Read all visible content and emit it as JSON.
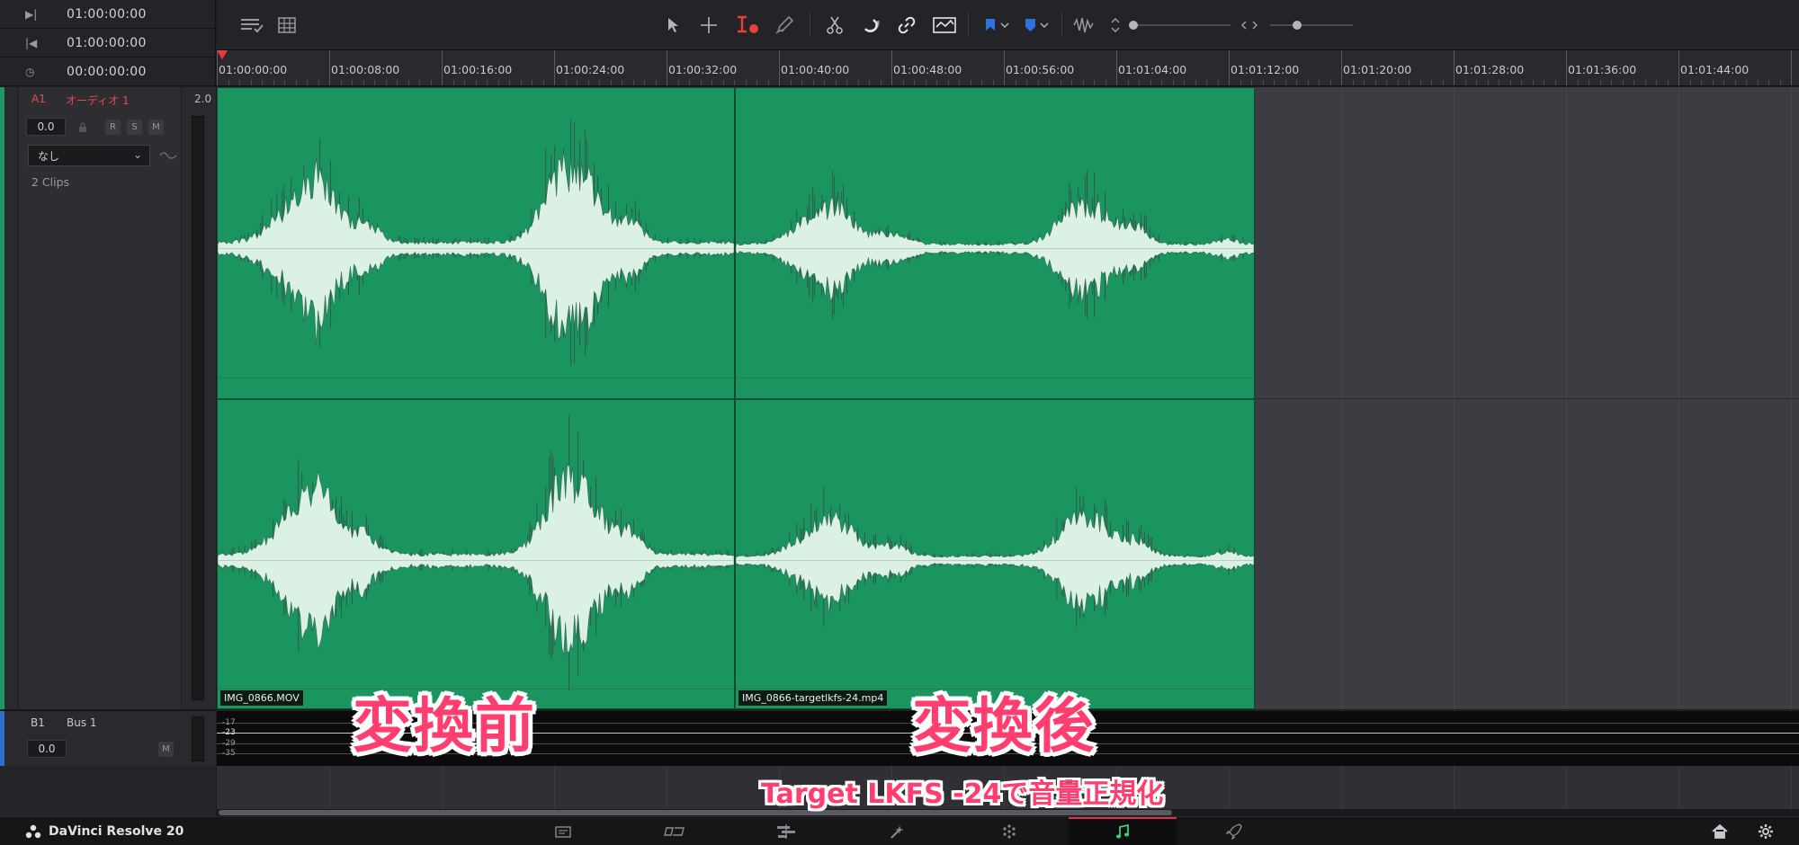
{
  "timecodes": [
    {
      "icon": "skip-forward-icon",
      "value": "01:00:00:00"
    },
    {
      "icon": "skip-back-icon",
      "value": "01:00:00:00"
    },
    {
      "icon": "clock-icon",
      "value": "00:00:00:00"
    }
  ],
  "ruler": {
    "labels": [
      "01:00:00:00",
      "01:00:08:00",
      "01:00:16:00",
      "01:00:24:00",
      "01:00:32:00",
      "01:00:40:00",
      "01:00:48:00",
      "01:00:56:00",
      "01:01:04:00",
      "01:01:12:00",
      "01:01:20:00",
      "01:01:28:00",
      "01:01:36:00",
      "01:01:44:00"
    ]
  },
  "tracks": {
    "a1": {
      "id": "A1",
      "name": "オーディオ 1",
      "channels": "2.0",
      "volume": "0.0",
      "buttons": [
        "R",
        "S",
        "M"
      ],
      "effect": "なし",
      "clips_label": "2 Clips",
      "accent": "#1c9a62",
      "clips": [
        {
          "name": "IMG_0866.MOV"
        },
        {
          "name": "IMG_0866-targetlkfs-24.mp4"
        }
      ]
    },
    "b1": {
      "id": "B1",
      "name": "Bus 1",
      "volume": "0.0",
      "mute": "M",
      "accent": "#2f6fd1",
      "meter_labels": [
        "-17",
        "-23",
        "-29",
        "-35"
      ]
    }
  },
  "overlays": {
    "before": "変換前",
    "after": "変換後",
    "caption": "Target LKFS -24で音量正規化"
  },
  "app": {
    "name": "DaVinci Resolve 20"
  },
  "colors": {
    "clip_green": "#1a955f",
    "waveform": "#dcf1e6",
    "overlay_text": "#ff3d6e",
    "active_tab": "#e0304b",
    "fairlight_icon": "#3ad07a"
  }
}
